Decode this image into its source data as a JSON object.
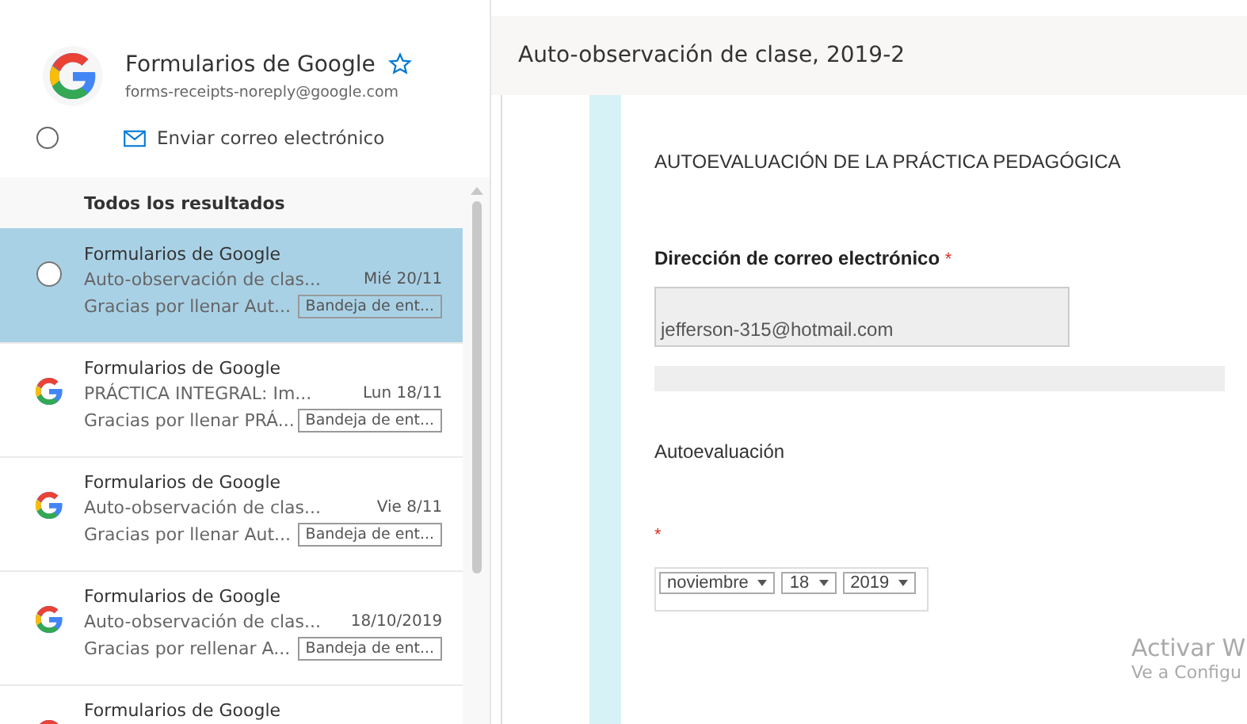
{
  "sender": {
    "name": "Formularios de Google",
    "starred": false,
    "email": "forms-receipts-noreply@google.com",
    "action": "Enviar correo electrónico",
    "selected": false
  },
  "list": {
    "header": "Todos los resultados",
    "rows": [
      {
        "sender": "Formularios de Google",
        "subject": "Auto-observación de clas...",
        "date": "Mié 20/11",
        "preview": "Gracias por llenar Aut...",
        "folder": "Bandeja de ent...",
        "selected": true
      },
      {
        "sender": "Formularios de Google",
        "subject": "PRÁCTICA INTEGRAL: Im...",
        "date": "Lun 18/11",
        "preview": "Gracias por llenar PRÁ...",
        "folder": "Bandeja de ent...",
        "selected": false
      },
      {
        "sender": "Formularios de Google",
        "subject": "Auto-observación de clas...",
        "date": "Vie 8/11",
        "preview": "Gracias por llenar Aut...",
        "folder": "Bandeja de ent...",
        "selected": false
      },
      {
        "sender": "Formularios de Google",
        "subject": "Auto-observación de clas...",
        "date": "18/10/2019",
        "preview": "Gracias por rellenar A...",
        "folder": "Bandeja de ent...",
        "selected": false
      },
      {
        "sender": "Formularios de Google",
        "selected": false
      }
    ]
  },
  "message": {
    "subject": "Auto-observación de clase, 2019-2",
    "form": {
      "title": "AUTOEVALUACIÓN DE LA PRÁCTICA PEDAGÓGICA",
      "email_label": "Dirección de correo electrónico",
      "required_mark": "*",
      "email_value": "jefferson-315@hotmail.com",
      "section": "Autoevaluación",
      "date_required_mark": "*",
      "date": [
        {
          "value": "noviembre"
        },
        {
          "value": "18"
        },
        {
          "value": "2019"
        }
      ]
    }
  },
  "os_notice": {
    "title": "Activar W",
    "subtitle": "Ve a Configu"
  }
}
